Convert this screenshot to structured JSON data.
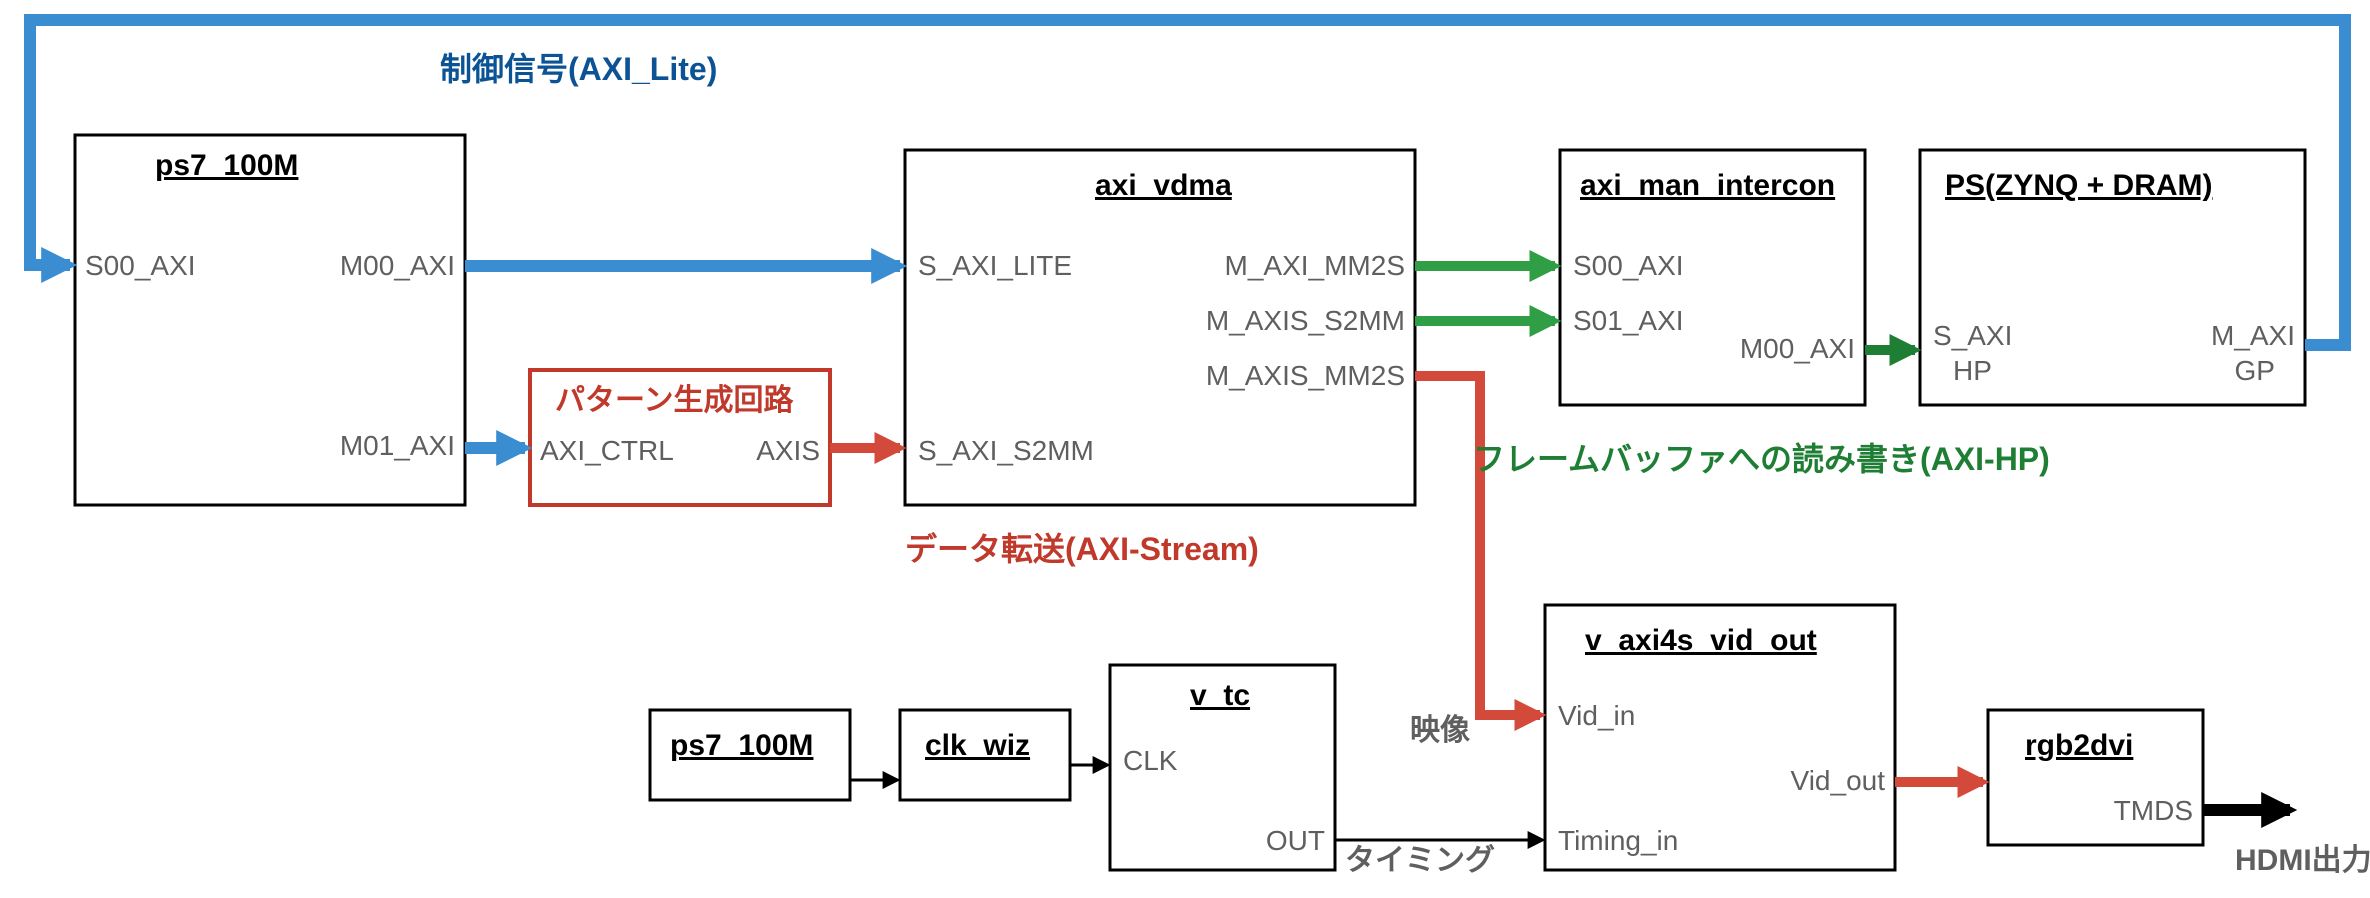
{
  "legend": {
    "control": "制御信号(AXI_Lite)",
    "stream": "データ転送(AXI-Stream)",
    "framebuf": "フレームバッファへの読み書き(AXI-HP)",
    "video": "映像",
    "timing": "タイミング",
    "hdmi_out": "HDMI出力"
  },
  "blocks": {
    "ps7_100m_a": {
      "title": "ps7_100M",
      "ports": {
        "s00_axi": "S00_AXI",
        "m00_axi": "M00_AXI",
        "m01_axi": "M01_AXI"
      }
    },
    "pattern_gen": {
      "title": "パターン生成回路",
      "ports": {
        "axi_ctrl": "AXI_CTRL",
        "axis": "AXIS"
      }
    },
    "axi_vdma": {
      "title": "axi_vdma",
      "ports": {
        "s_axi_lite": "S_AXI_LITE",
        "s_axi_s2mm": "S_AXI_S2MM",
        "m_axi_mm2s": "M_AXI_MM2S",
        "m_axis_s2mm": "M_AXIS_S2MM",
        "m_axis_mm2s": "M_AXIS_MM2S"
      }
    },
    "axi_man_intercon": {
      "title": "axi_man_intercon",
      "ports": {
        "s00_axi": "S00_AXI",
        "s01_axi": "S01_AXI",
        "m00_axi": "M00_AXI"
      }
    },
    "ps_zynq_dram": {
      "title": "PS(ZYNQ + DRAM)",
      "ports": {
        "s_axi_hp_l1": "S_AXI",
        "s_axi_hp_l2": "HP",
        "m_axi_gp_l1": "M_AXI",
        "m_axi_gp_l2": "GP"
      }
    },
    "ps7_100m_b": {
      "title": "ps7_100M"
    },
    "clk_wiz": {
      "title": "clk_wiz"
    },
    "v_tc": {
      "title": "v_tc",
      "ports": {
        "clk": "CLK",
        "out": "OUT"
      }
    },
    "v_axi4s_vid_out": {
      "title": "v_axi4s_vid_out",
      "ports": {
        "vid_in": "Vid_in",
        "timing_in": "Timing_in",
        "vid_out": "Vid_out"
      }
    },
    "rgb2dvi": {
      "title": "rgb2dvi",
      "ports": {
        "tmds": "TMDS"
      }
    }
  },
  "colors": {
    "blue": "#3b8dd1",
    "red": "#d44a3a",
    "green": "#2f9e44",
    "dark_green": "#1e7e34",
    "box_red": "#c0392b"
  }
}
